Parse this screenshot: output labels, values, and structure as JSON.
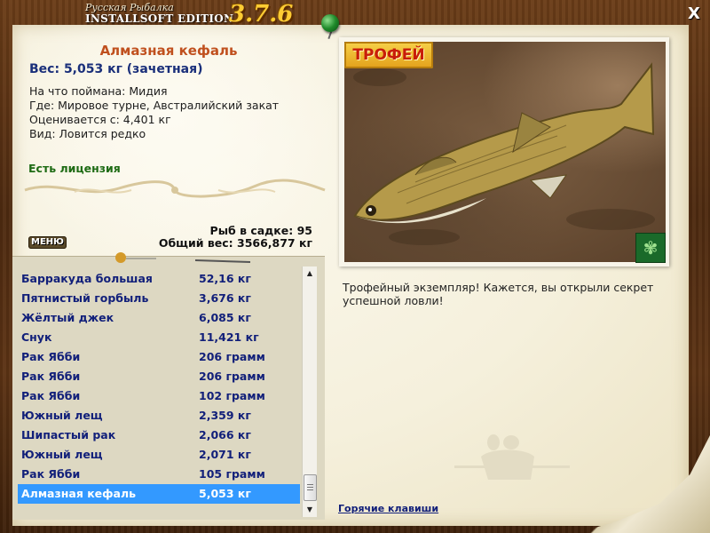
{
  "app": {
    "logo_sub": "Русская Рыбалка",
    "logo_main": "INSTALLSOFT EDITION",
    "version": "3.7.6",
    "close_label": "X"
  },
  "fish": {
    "name": "Алмазная кефаль",
    "weight_line": "Вес: 5,053 кг (зачетная)",
    "caught_on": "На что поймана: Мидия",
    "location": "Где: Мировое турне, Австралийский закат",
    "valued_from": "Оценивается с: 4,401 кг",
    "kind": "Вид: Ловится редко",
    "license": "Есть лицензия"
  },
  "keepnet": {
    "count": "Рыб в садке: 95",
    "total_weight": "Общий вес: 3566,877 кг"
  },
  "menu_label": "МЕНЮ",
  "catch_list": [
    {
      "name": "Барракуда большая",
      "weight": "52,16 кг"
    },
    {
      "name": "Пятнистый горбыль",
      "weight": "3,676 кг"
    },
    {
      "name": "Жёлтый джек",
      "weight": "6,085 кг"
    },
    {
      "name": "Снук",
      "weight": "11,421 кг"
    },
    {
      "name": "Рак Ябби",
      "weight": "206 грамм"
    },
    {
      "name": "Рак Ябби",
      "weight": "206 грамм"
    },
    {
      "name": "Рак Ябби",
      "weight": "102 грамм"
    },
    {
      "name": "Южный лещ",
      "weight": "2,359 кг"
    },
    {
      "name": "Шипастый рак",
      "weight": "2,066 кг"
    },
    {
      "name": "Южный лещ",
      "weight": "2,071 кг"
    },
    {
      "name": "Рак Ябби",
      "weight": "105 грамм"
    },
    {
      "name": "Алмазная кефаль",
      "weight": "5,053 кг",
      "selected": true
    }
  ],
  "trophy": {
    "badge": "ТРОФЕЙ",
    "text": "Трофейный экземпляр! Кажется, вы открыли секрет успешной ловли!"
  },
  "hotkeys_label": "Горячие клавиши",
  "colors": {
    "selected_row": "#3399ff",
    "list_text": "#12207a",
    "fish_name": "#c0501e",
    "license": "#1e6b14"
  },
  "icons": {
    "close": "close-icon",
    "butterfly": "butterfly-icon",
    "pin": "pin-icon",
    "scroll_up": "scroll-up-arrow-icon",
    "scroll_down": "scroll-down-arrow-icon"
  }
}
